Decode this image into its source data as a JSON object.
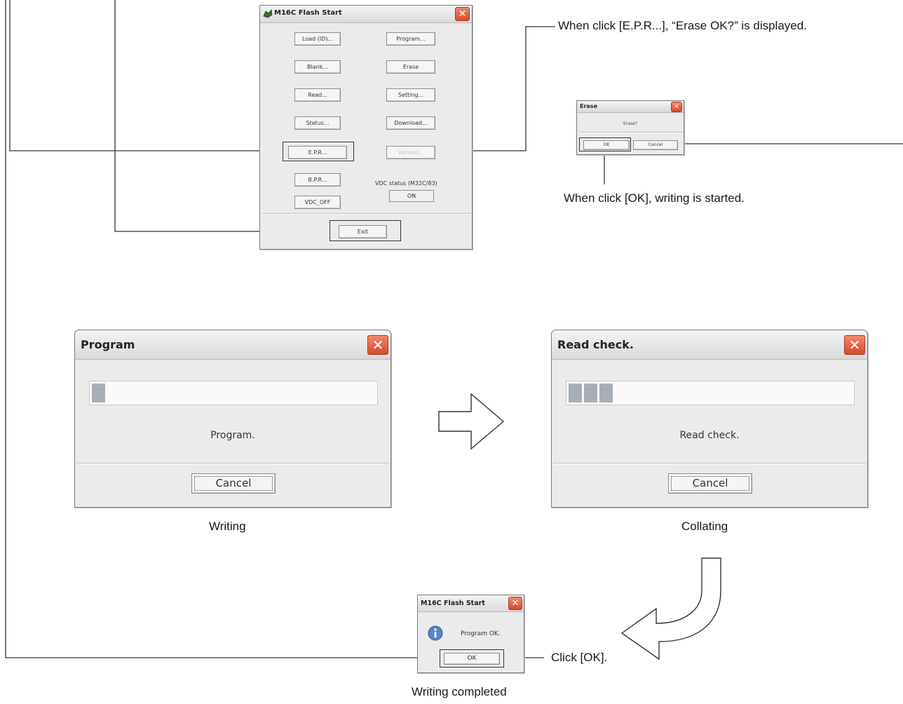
{
  "main_window": {
    "title": "M16C Flash Start",
    "buttons_left": [
      "Load (ID)...",
      "Blank...",
      "Read...",
      "Status...",
      "E.P.R...",
      "B.P.R...",
      "VDC_OFF"
    ],
    "buttons_right": [
      "Program...",
      "Erase",
      "Setting...",
      "Download...",
      "Version..."
    ],
    "vdc_status_label": "VDC status (M32C/83)",
    "vdc_status_value": "ON",
    "exit_label": "Exit"
  },
  "erase_dialog": {
    "title": "Erase",
    "message": "Erase?",
    "ok_label": "OK",
    "cancel_label": "Cancel"
  },
  "program_dialog": {
    "title": "Program",
    "status_text": "Program.",
    "cancel_label": "Cancel",
    "progress_blocks": 1
  },
  "readcheck_dialog": {
    "title": "Read check.",
    "status_text": "Read check.",
    "cancel_label": "Cancel",
    "progress_blocks": 3
  },
  "complete_dialog": {
    "title": "M16C Flash Start",
    "message": "Program OK.",
    "ok_label": "OK",
    "icon": "info-icon"
  },
  "captions": {
    "epr_note": "When click [E.P.R...], “Erase OK?” is displayed.",
    "ok_note": "When click [OK], writing is started.",
    "writing": "Writing",
    "collating": "Collating",
    "click_ok": "Click [OK].",
    "writing_completed": "Writing completed"
  },
  "colors": {
    "window_bg": "#ebebeb",
    "close_red": "#d9482a",
    "progress_fill": "#a8aeb6",
    "line": "#333333"
  }
}
